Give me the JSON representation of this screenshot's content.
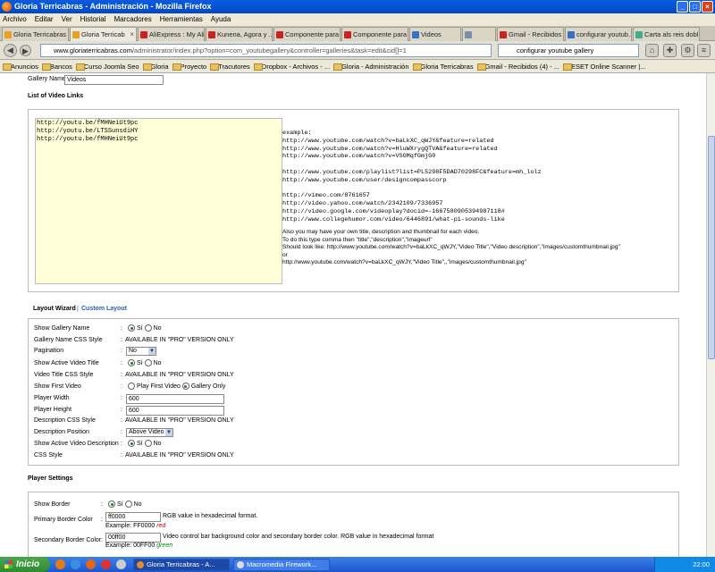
{
  "window": {
    "title": "Gloria Terricabras - Administración - Mozilla Firefox"
  },
  "menu": [
    "Archivo",
    "Editar",
    "Ver",
    "Historial",
    "Marcadores",
    "Herramientas",
    "Ayuda"
  ],
  "tabs": [
    {
      "label": "Gloria Terricabras",
      "icon": "joomla-icon"
    },
    {
      "label": "Gloria Terricab",
      "icon": "joomla-icon",
      "active": true
    },
    {
      "label": "AliExpress : My Ali...",
      "icon": "aliexpress-icon"
    },
    {
      "label": "Kunena, Agora y ...",
      "icon": "page-icon"
    },
    {
      "label": "Componente para ...",
      "icon": "page-icon"
    },
    {
      "label": "Componente para ...",
      "icon": "page-icon"
    },
    {
      "label": "Videos",
      "icon": "page-icon"
    },
    {
      "label": "",
      "icon": "page-icon"
    },
    {
      "label": "Gmail - Recibidos - ...",
      "icon": "gmail-icon"
    },
    {
      "label": "configurar youtub...",
      "icon": "google-icon"
    },
    {
      "label": "Carta als reis dobl...",
      "icon": "page-icon"
    }
  ],
  "address": {
    "domain": "www.gloriaterricabras.com",
    "path": "/administrator/index.php?option=com_youtubegallery&controller=galleries&task=edit&cid[]=1"
  },
  "search": {
    "value": "configurar youtube gallery"
  },
  "bookmarks": [
    "Anuncios",
    "Bancos",
    "Curso Joomla Seo",
    "Gloria",
    "Proyecto",
    "Tracutores",
    "Dropbox - Archivos - ...",
    "Gloria - Administración",
    "Gloria Terricabras",
    "Gmail - Recibidos (4) - ...",
    "ESET Online Scanner |..."
  ],
  "form": {
    "gallery_name_label": "Gallery Name",
    "gallery_name_value": "Videos",
    "list_heading": "List of Video Links",
    "links": "http://youtu.be/fMHNeiUt9pc\nhttp://youtu.be/LTSSunsdiHY\nhttp://youtu.be/fMHNeiUt9pc",
    "example_code": "example:\nhttp://www.youtube.com/watch?v=baLkXC_qWJY&feature=related\nhttp://www.youtube.com/watch?v=HluWXrygQTVA&feature=related\nhttp://www.youtube.com/watch?v=VSGMqfGmjG0\n\nhttp://www.youtube.com/playlist?list=PL5298F5DAD70298FC&feature=mh_lolz\nhttp://www.youtube.com/user/designcompasscorp\n\nhttp://vimeo.com/8761657\nhttp://video.yahoo.com/watch/2342109/7336957\nhttp://video.google.com/videoplay?docid=-1667580905394987118#\nhttp://www.collegehumor.com/video/6446891/what-pi-sounds-like",
    "example_text": [
      "Also you may have your own title, description and thumbnail for each video.",
      "To do this type comma then \"title\",\"description\",\"imageurl\"",
      "Should look like: http://www.youtube.com/watch?v=baLkXC_qWJY,\"Video Title\",\"Video description\",\"images/customthumbnail.jpg\"",
      "or",
      "http://www.youtube.com/watch?v=baLkXC_qWJY,\"Video Title\",,\"images/customthumbnail.jpg\""
    ]
  },
  "layout_wizard": {
    "tab_active": "Layout Wizard",
    "separator": "|",
    "tab_link": "Custom Layout",
    "rows": [
      {
        "label": "Show Gallery Name",
        "type": "radio",
        "opts": [
          "Sí",
          "No"
        ],
        "on": 0
      },
      {
        "label": "Gallery Name CSS Style",
        "type": "text",
        "value": "AVAILABLE IN \"PRO\" VERSION ONLY"
      },
      {
        "label": "Pagination",
        "type": "select",
        "value": "No"
      },
      {
        "label": "Show Active Video Title",
        "type": "radio",
        "opts": [
          "Sí",
          "No"
        ],
        "on": 0
      },
      {
        "label": "Video Title CSS Style",
        "type": "text",
        "value": "AVAILABLE IN \"PRO\" VERSION ONLY"
      },
      {
        "label": "Show First Video",
        "type": "radio",
        "opts": [
          "Play First Video",
          "Gallery Only"
        ],
        "on": 1
      },
      {
        "label": "Player Width",
        "type": "input",
        "value": "600"
      },
      {
        "label": "Player Height",
        "type": "input",
        "value": "600"
      },
      {
        "label": "Description CSS Style",
        "type": "text",
        "value": "AVAILABLE IN \"PRO\" VERSION ONLY"
      },
      {
        "label": "Description Position",
        "type": "select",
        "value": "Above Video"
      },
      {
        "label": "Show Active Video Description",
        "type": "radio",
        "opts": [
          "Sí",
          "No"
        ],
        "on": 0
      },
      {
        "label": "CSS Style",
        "type": "text",
        "value": "AVAILABLE IN \"PRO\" VERSION ONLY"
      }
    ]
  },
  "player_settings": {
    "heading": "Player Settings",
    "show_border_label": "Show Border",
    "show_border_opts": [
      "Sí",
      "No"
    ],
    "primary_label": "Primary Border Color",
    "primary_value": "ff0000",
    "primary_hint": "RGB value in hexadecimal format.",
    "primary_example": "Example: FF0000 ",
    "primary_example_word": "red",
    "secondary_label": "Secondary Border Color",
    "secondary_value": "00ff00",
    "secondary_hint": "Video control bar background color and secondary border color. RGB value in hexadecimal format",
    "secondary_example": "Example: 00FF00 ",
    "secondary_example_word": "green"
  },
  "taskbar": {
    "start": "Inicio",
    "tasks": [
      {
        "label": "Gloria Terricabras - A...",
        "active": true
      },
      {
        "label": "Macromedia Firework..."
      }
    ],
    "clock": "22:00"
  },
  "colors": {
    "accent": "#1d56d0",
    "link": "#2a5db0",
    "textarea_bg": "#ffffd8"
  }
}
